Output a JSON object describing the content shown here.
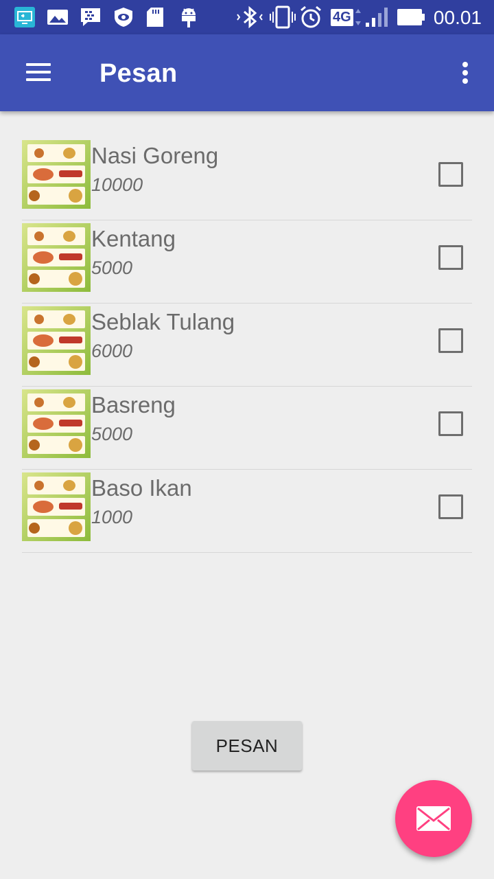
{
  "status_bar": {
    "time": "00.01",
    "network": "4G",
    "icons": [
      "screen-mirror-icon",
      "gallery-icon",
      "bbm-icon",
      "eye-icon",
      "sd-card-icon",
      "android-debug-icon",
      "bluetooth-icon",
      "vibrate-icon",
      "alarm-icon",
      "network-4g-icon",
      "signal-icon",
      "battery-icon"
    ]
  },
  "app_bar": {
    "title": "Pesan",
    "menu_icon": "hamburger-menu-icon",
    "overflow_icon": "more-vert-icon"
  },
  "menu_items": [
    {
      "name": "Nasi Goreng",
      "price": "10000",
      "checked": false
    },
    {
      "name": "Kentang",
      "price": "5000",
      "checked": false
    },
    {
      "name": "Seblak Tulang",
      "price": "6000",
      "checked": false
    },
    {
      "name": "Basreng",
      "price": "5000",
      "checked": false
    },
    {
      "name": "Baso Ikan",
      "price": "1000",
      "checked": false
    }
  ],
  "order_button": {
    "label": "PESAN"
  },
  "fab": {
    "icon": "mail-icon",
    "color": "#ff4081"
  },
  "colors": {
    "primary": "#3f51b5",
    "primary_dark": "#303f9f",
    "accent": "#ff4081"
  }
}
